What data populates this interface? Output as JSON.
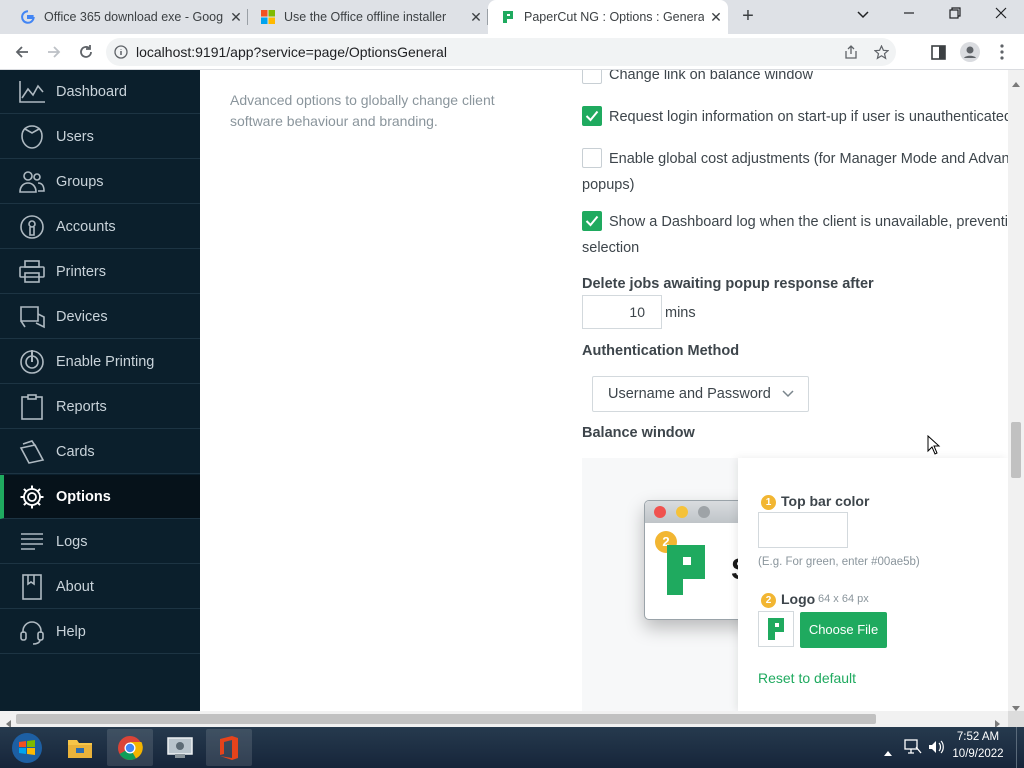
{
  "browser": {
    "tabs": [
      {
        "title": "Office 365 download exe - Goog",
        "favicon": "google-g-icon"
      },
      {
        "title": "Use the Office offline installer",
        "favicon": "microsoft-logo-icon"
      },
      {
        "title": "PaperCut NG : Options : General",
        "favicon": "papercut-logo-icon",
        "active": true
      }
    ],
    "url": "localhost:9191/app?service=page/OptionsGeneral"
  },
  "sidebar": {
    "items": [
      {
        "label": "Dashboard",
        "icon": "dashboard-chart-icon"
      },
      {
        "label": "Users",
        "icon": "users-icon"
      },
      {
        "label": "Groups",
        "icon": "groups-icon"
      },
      {
        "label": "Accounts",
        "icon": "accounts-icon"
      },
      {
        "label": "Printers",
        "icon": "printer-icon"
      },
      {
        "label": "Devices",
        "icon": "devices-icon"
      },
      {
        "label": "Enable Printing",
        "icon": "enable-printing-icon"
      },
      {
        "label": "Reports",
        "icon": "reports-clipboard-icon"
      },
      {
        "label": "Cards",
        "icon": "cards-icon"
      },
      {
        "label": "Options",
        "icon": "gear-icon",
        "active": true
      },
      {
        "label": "Logs",
        "icon": "logs-icon"
      },
      {
        "label": "About",
        "icon": "about-book-icon"
      },
      {
        "label": "Help",
        "icon": "help-headset-icon"
      }
    ]
  },
  "section": {
    "description": "Advanced options to globally change client software behaviour and branding."
  },
  "options": {
    "change_link": {
      "label": "Change link on balance window",
      "checked": false
    },
    "request_login": {
      "label": "Request login information on start-up if user is unauthenticated",
      "checked": true
    },
    "global_cost": {
      "label_line1": "Enable global cost adjustments (for Manager Mode and Advance",
      "label_line2": "popups)",
      "checked": false
    },
    "dashboard_log": {
      "label_line1": "Show a Dashboard log when the client is unavailable, preventing",
      "label_line2": "selection",
      "checked": true
    }
  },
  "delete_jobs": {
    "label": "Delete jobs awaiting popup response after",
    "value": "10",
    "unit": "mins"
  },
  "auth": {
    "label": "Authentication Method",
    "selected": "Username and Password"
  },
  "balance": {
    "label": "Balance window",
    "topbar_badge": "1",
    "topbar_label": "Top bar color",
    "topbar_hint": "(E.g. For green, enter #00ae5b)",
    "logo_badge": "2",
    "logo_label": "Logo",
    "logo_size": "64 x 64 px",
    "choose_file": "Choose File",
    "reset": "Reset to default",
    "preview_badge": "2",
    "preview_letter": "S"
  },
  "taskbar": {
    "time": "7:52 AM",
    "date": "10/9/2022"
  },
  "colors": {
    "sidebar_bg": "#0b1f2c",
    "accent_green": "#1faa5f",
    "badge_yellow": "#f2b632"
  }
}
